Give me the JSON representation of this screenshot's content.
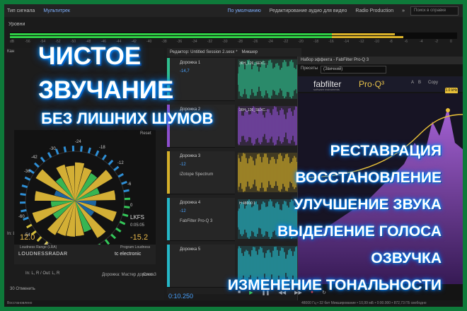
{
  "menu": {
    "items": [
      "Тип сигнала",
      "Мультитрек",
      "По умолчанию",
      "Редактирование аудио для видео",
      "Radio Production"
    ],
    "active_index": 1,
    "search_placeholder": "Поиск в справке"
  },
  "levels": {
    "title": "Уровни",
    "green_fraction": 0.72,
    "yellow_fraction": 0.14,
    "green2_fraction": 0.72,
    "yellow2_fraction": 0.16
  },
  "ruler_ticks": [
    "dB",
    "-56",
    "-54",
    "-52",
    "-50",
    "-48",
    "-46",
    "-44",
    "-42",
    "-40",
    "-38",
    "-36",
    "-34",
    "-32",
    "-30",
    "-28",
    "-26",
    "-24",
    "-22",
    "-20",
    "-18",
    "-16",
    "-14",
    "-12",
    "-10",
    "-8",
    "-6",
    "-4",
    "-2",
    "0"
  ],
  "editor": {
    "tab_label": "Редактор: Untitled Session 2.sesx *",
    "mixer_label": "Микшер",
    "tracks": [
      {
        "name": "Дорожка 1",
        "volume": "-14,7",
        "color": "#2fbf8f",
        "fx": "",
        "clip": "36H_126_SEXC..."
      },
      {
        "name": "Дорожка 2",
        "volume": "-6,7",
        "color": "#8e4fcf",
        "fx": "",
        "clip": "36H_126_SEXC..."
      },
      {
        "name": "Дорожка 3",
        "volume": "-12",
        "color": "#d6b02a",
        "fx": "iZotope Spectrum",
        "clip": ""
      },
      {
        "name": "Дорожка 4",
        "volume": "-12",
        "color": "#25b8c8",
        "fx": "FabFilter Pro-Q 3",
        "clip": "Н 48000 1"
      },
      {
        "name": "Дорожка 5",
        "volume": "",
        "color": "#25b8c8",
        "fx": "",
        "clip": ""
      }
    ],
    "time": "0:10.250"
  },
  "radar": {
    "ticks": [
      "-30",
      "-24",
      "-18",
      "-12",
      "-6",
      "0",
      "-48",
      "-54",
      "-60",
      "-36",
      "-42"
    ],
    "lkfs": "LKFS",
    "timer": "0:05:05",
    "loudness_range": "12.0",
    "program_loudness": "-15.2",
    "lra_label": "Loudness Range (LRA)",
    "pl_label": "Program Loudness",
    "brand": "LOUDNESSRADAR",
    "maker": "tc electronic",
    "reset_label": "Reset"
  },
  "left_labels": {
    "mode": "In: L, R / Out: L, R",
    "deck": "Дорожка: Мастер дорожка",
    "slot": "Слот 3",
    "cancel": "30 Отменить",
    "ready": "Восстановлено"
  },
  "effect": {
    "title": "Набор эффекта - FabFilter Pro-Q 3",
    "presets_label": "Пресеты",
    "preset_value": "(Звичний)",
    "logo": "fabfilter",
    "logo_sub": "software instruments",
    "product": "Pro·Q³",
    "freq_badge": "1.0 kHz",
    "controls": [
      "A",
      "B",
      "Copy"
    ]
  },
  "overlay": {
    "line1": "ЧИСТОЕ",
    "line2": "ЗВУЧАНИЕ",
    "line3": "БЕЗ ЛИШНИХ ШУМОВ",
    "features": [
      "РЕСТАВРАЦИЯ",
      "ВОССТАНОВЛЕНИЕ",
      "УЛУЧШЕНИЕ ЗВУКА",
      "ВЫДЕЛЕНИЕ ГОЛОСА",
      "ОЗВУЧКА",
      "ИЗМЕНЕНИЕ ТОНАЛЬНОСТИ"
    ]
  },
  "status": {
    "left": "Восстановлено",
    "right": "48000 Гц • 32 бит Микширование • 10,99 мБ • 0:00.000 • 872,73 ГБ свободно"
  },
  "colors": {
    "accent": "#4aa3ff",
    "green": "#2fcf45",
    "yellow": "#d9b12a",
    "purple": "#8e4fcf",
    "teal": "#25b8c8"
  }
}
